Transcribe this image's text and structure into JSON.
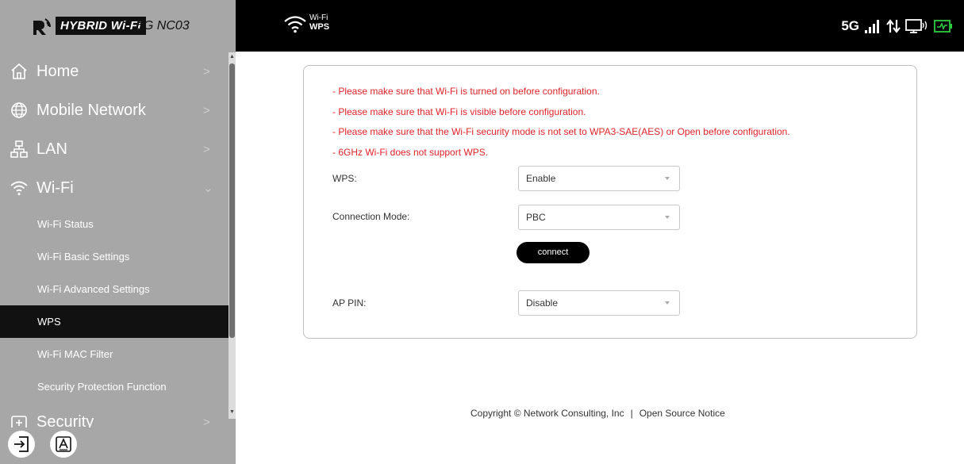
{
  "brand": {
    "badge": "HYBRID Wi-Fi",
    "model": "5G NC03"
  },
  "sidebar": {
    "items": [
      {
        "label": "Home",
        "icon": "home-icon",
        "chevron": ">"
      },
      {
        "label": "Mobile Network",
        "icon": "globe-icon",
        "chevron": ">"
      },
      {
        "label": "LAN",
        "icon": "network-icon",
        "chevron": ">"
      },
      {
        "label": "Wi-Fi",
        "icon": "wifi-icon",
        "chevron": "⌄"
      }
    ],
    "subitems": [
      {
        "label": "Wi-Fi Status"
      },
      {
        "label": "Wi-Fi Basic Settings"
      },
      {
        "label": "Wi-Fi Advanced Settings"
      },
      {
        "label": "WPS",
        "active": true
      },
      {
        "label": "Wi-Fi MAC Filter"
      },
      {
        "label": "Security Protection Function"
      }
    ],
    "security": {
      "label": "Security",
      "icon": "security-icon",
      "chevron": ">"
    }
  },
  "topbar": {
    "section": "Wi-Fi",
    "page": "WPS",
    "network_type": "5G"
  },
  "notes": [
    "- Please make sure that Wi-Fi is turned on before configuration.",
    "- Please make sure that Wi-Fi is visible before configuration.",
    "- Please make sure that the Wi-Fi security mode is not set to WPA3-SAE(AES) or Open before configuration.",
    "- 6GHz Wi-Fi does not support WPS."
  ],
  "form": {
    "wps": {
      "label": "WPS:",
      "value": "Enable"
    },
    "connection_mode": {
      "label": "Connection Mode:",
      "value": "PBC"
    },
    "connect_button": "connect",
    "ap_pin": {
      "label": "AP PIN:",
      "value": "Disable"
    }
  },
  "footer": {
    "copyright": "Copyright © Network Consulting, Inc",
    "separator": "|",
    "link": "Open Source Notice"
  },
  "colors": {
    "accent_red": "#e0232a",
    "sidebar_bg": "#a7a7a7",
    "active_item": "#111111",
    "topbar_bg": "#000000",
    "battery_green": "#2ecc40"
  }
}
